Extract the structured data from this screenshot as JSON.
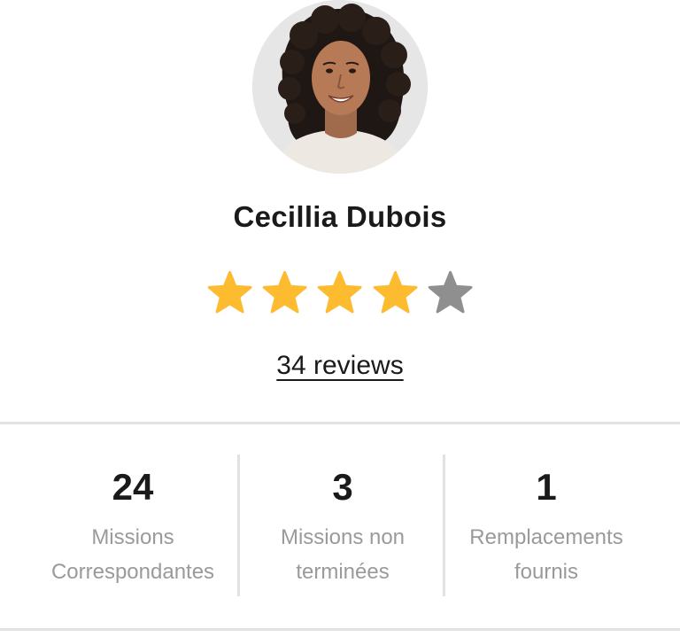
{
  "profile": {
    "name": "Cecillia Dubois",
    "avatar_icon": "person-portrait",
    "rating": 4,
    "rating_max": 5,
    "reviews_link": "34 reviews"
  },
  "colors": {
    "star_filled": "#FDBB30",
    "star_empty": "#8F8F8F",
    "label": "#9A9A9A",
    "divider": "#E2E2E2"
  },
  "stats": [
    {
      "value": "24",
      "label_line1": "Missions",
      "label_line2": "Correspondantes"
    },
    {
      "value": "3",
      "label_line1": "Missions non",
      "label_line2": "terminées"
    },
    {
      "value": "1",
      "label_line1": "Remplacements",
      "label_line2": "fournis"
    }
  ]
}
